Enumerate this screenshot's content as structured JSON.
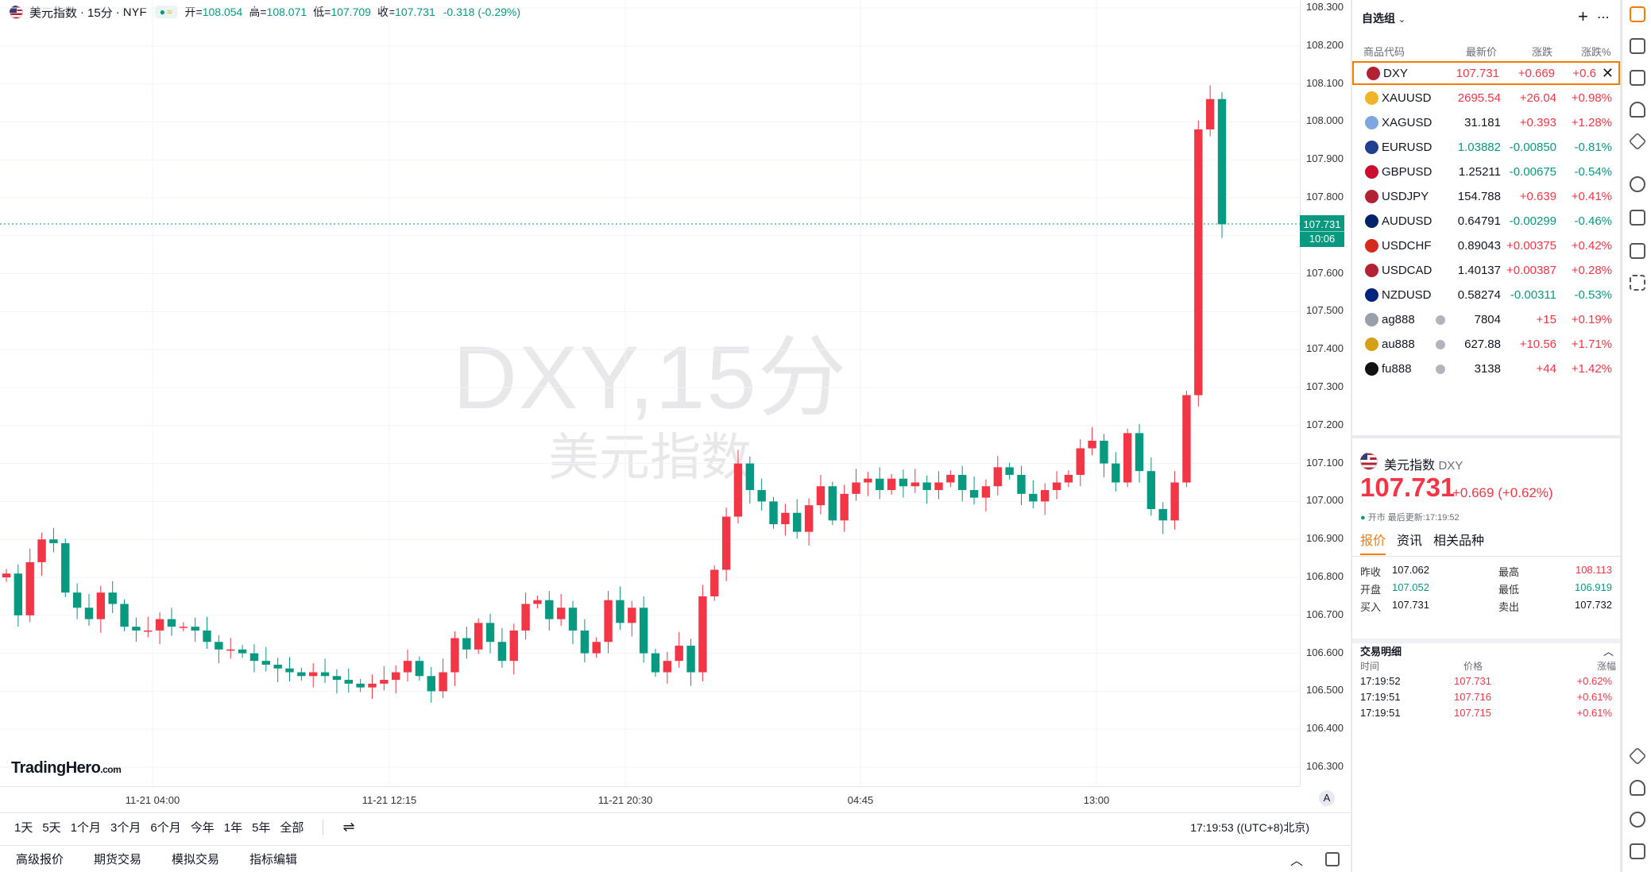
{
  "header": {
    "name": "美元指数",
    "interval": "15分",
    "exchange": "NYF",
    "status_sym": "≈",
    "open_label": "开=",
    "open": "108.054",
    "high_label": "高=",
    "high": "108.071",
    "low_label": "低=",
    "low": "107.709",
    "close_label": "收=",
    "close": "107.731",
    "change": "-0.318 (-0.29%)"
  },
  "watermark": {
    "line1": "DXY,15分",
    "line2": "美元指数"
  },
  "logo": "TradingHero",
  "logo_suffix": ".com",
  "price_axis": [
    "108.300",
    "108.200",
    "108.100",
    "108.000",
    "107.900",
    "107.800",
    "107.700",
    "107.600",
    "107.500",
    "107.400",
    "107.300",
    "107.200",
    "107.100",
    "107.000",
    "106.900",
    "106.800",
    "106.700",
    "106.600",
    "106.500",
    "106.400",
    "106.300"
  ],
  "price_tag": {
    "price": "107.731",
    "countdown": "10:06"
  },
  "time_axis": [
    {
      "label": "11-21 04:00",
      "x": 192
    },
    {
      "label": "11-21 12:15",
      "x": 490
    },
    {
      "label": "11-21 20:30",
      "x": 787
    },
    {
      "label": "04:45",
      "x": 1083
    },
    {
      "label": "13:00",
      "x": 1380
    }
  ],
  "auto_scale_label": "A",
  "ranges": [
    "1天",
    "5天",
    "1个月",
    "3个月",
    "6个月",
    "今年",
    "1年",
    "5年",
    "全部"
  ],
  "clock": "17:19:53 ((UTC+8)北京)",
  "bottom_tabs": [
    "高级报价",
    "期货交易",
    "模拟交易",
    "指标编辑"
  ],
  "chart_data": {
    "type": "candlestick",
    "symbol": "DXY",
    "interval": "15分",
    "ylim": [
      106.25,
      108.33
    ],
    "last_price": 107.731,
    "closes": [
      106.81,
      106.7,
      106.84,
      106.9,
      106.89,
      106.76,
      106.72,
      106.69,
      106.76,
      106.73,
      106.67,
      106.66,
      106.66,
      106.69,
      106.67,
      106.67,
      106.66,
      106.63,
      106.61,
      106.61,
      106.6,
      106.58,
      106.57,
      106.56,
      106.55,
      106.54,
      106.55,
      106.54,
      106.53,
      106.52,
      106.51,
      106.52,
      106.53,
      106.55,
      106.58,
      106.54,
      106.5,
      106.55,
      106.64,
      106.61,
      106.68,
      106.63,
      106.58,
      106.66,
      106.73,
      106.74,
      106.69,
      106.72,
      106.66,
      106.6,
      106.63,
      106.74,
      106.68,
      106.72,
      106.6,
      106.55,
      106.58,
      106.62,
      106.55,
      106.75,
      106.82,
      106.96,
      107.1,
      107.03,
      107.0,
      106.94,
      106.97,
      106.92,
      106.99,
      107.04,
      106.95,
      107.02,
      107.05,
      107.06,
      107.03,
      107.06,
      107.04,
      107.05,
      107.03,
      107.05,
      107.07,
      107.03,
      107.01,
      107.04,
      107.09,
      107.07,
      107.02,
      107.0,
      107.03,
      107.05,
      107.07,
      107.14,
      107.16,
      107.1,
      107.05,
      107.18,
      107.08,
      106.98,
      106.95,
      107.05,
      107.28,
      107.98,
      108.06,
      107.73
    ]
  },
  "watchlist": {
    "title": "自选组",
    "add_icon": "+",
    "more_icon": "⋯",
    "columns": [
      "商品代码",
      "最新价",
      "涨跌",
      "涨跌%"
    ],
    "rows": [
      {
        "sym": "DXY",
        "price": "107.731",
        "chg": "+0.669",
        "pct": "+0.6",
        "dir": "up",
        "icon": "us-flag",
        "color": "#b22234",
        "selected": true
      },
      {
        "sym": "XAUUSD",
        "price": "2695.54",
        "chg": "+26.04",
        "pct": "+0.98%",
        "dir": "up",
        "icon": "gold-coin",
        "color": "#f0b429"
      },
      {
        "sym": "XAGUSD",
        "price": "31.181",
        "chg": "+0.393",
        "pct": "+1.28%",
        "dir": "up",
        "icon": "silver-coin",
        "color": "#7fa6e0"
      },
      {
        "sym": "EURUSD",
        "price": "1.03882",
        "chg": "-0.00850",
        "pct": "-0.81%",
        "dir": "dn",
        "icon": "eu-us-flag",
        "color": "#1f3f8f"
      },
      {
        "sym": "GBPUSD",
        "price": "1.25211",
        "chg": "-0.00675",
        "pct": "-0.54%",
        "dir": "dn",
        "icon": "gb-us-flag",
        "color": "#c8102e"
      },
      {
        "sym": "USDJPY",
        "price": "154.788",
        "chg": "+0.639",
        "pct": "+0.41%",
        "dir": "up",
        "icon": "us-jp-flag",
        "color": "#b22234"
      },
      {
        "sym": "AUDUSD",
        "price": "0.64791",
        "chg": "-0.00299",
        "pct": "-0.46%",
        "dir": "dn",
        "icon": "au-us-flag",
        "color": "#012169"
      },
      {
        "sym": "USDCHF",
        "price": "0.89043",
        "chg": "+0.00375",
        "pct": "+0.42%",
        "dir": "up",
        "icon": "us-ch-flag",
        "color": "#d52b1e"
      },
      {
        "sym": "USDCAD",
        "price": "1.40137",
        "chg": "+0.00387",
        "pct": "+0.28%",
        "dir": "up",
        "icon": "us-ca-flag",
        "color": "#b22234"
      },
      {
        "sym": "NZDUSD",
        "price": "0.58274",
        "chg": "-0.00311",
        "pct": "-0.53%",
        "dir": "dn",
        "icon": "nz-us-flag",
        "color": "#00247d"
      },
      {
        "sym": "ag888",
        "price": "7804",
        "chg": "+15",
        "pct": "+0.19%",
        "dir": "up",
        "icon": "ag-coin",
        "color": "#9aa0aa",
        "closed": true
      },
      {
        "sym": "au888",
        "price": "627.88",
        "chg": "+10.56",
        "pct": "+1.71%",
        "dir": "up",
        "icon": "au-coin",
        "color": "#d4a017",
        "closed": true
      },
      {
        "sym": "fu888",
        "price": "3138",
        "chg": "+44",
        "pct": "+1.42%",
        "dir": "up",
        "icon": "fuel-drop",
        "color": "#111111",
        "closed": true
      }
    ]
  },
  "detail": {
    "name": "美元指数",
    "code": "DXY",
    "price": "107.731",
    "change": "+0.669 (+0.62%)",
    "market_status": "开市",
    "updated": "最后更新:17:19:52",
    "tabs": [
      "报价",
      "资讯",
      "相关品种"
    ],
    "stats": [
      {
        "l1": "昨收",
        "v1": "107.062",
        "c1": "",
        "l2": "最高",
        "v2": "108.113",
        "c2": "up"
      },
      {
        "l1": "开盘",
        "v1": "107.052",
        "c1": "dn",
        "l2": "最低",
        "v2": "106.919",
        "c2": "dn"
      },
      {
        "l1": "买入",
        "v1": "107.731",
        "c1": "",
        "l2": "卖出",
        "v2": "107.732",
        "c2": ""
      }
    ],
    "trades_title": "交易明细",
    "trades_cols": [
      "时间",
      "价格",
      "涨幅"
    ],
    "trades": [
      {
        "t": "17:19:52",
        "p": "107.731",
        "c": "+0.62%"
      },
      {
        "t": "17:19:51",
        "p": "107.716",
        "c": "+0.61%"
      },
      {
        "t": "17:19:51",
        "p": "107.715",
        "c": "+0.61%"
      }
    ]
  }
}
